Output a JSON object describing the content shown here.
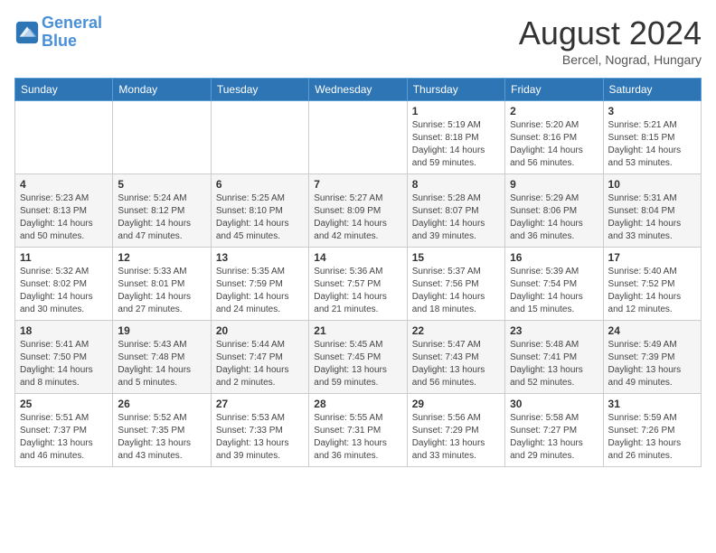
{
  "header": {
    "logo_line1": "General",
    "logo_line2": "Blue",
    "month_year": "August 2024",
    "location": "Bercel, Nograd, Hungary"
  },
  "weekdays": [
    "Sunday",
    "Monday",
    "Tuesday",
    "Wednesday",
    "Thursday",
    "Friday",
    "Saturday"
  ],
  "weeks": [
    [
      {
        "day": "",
        "info": ""
      },
      {
        "day": "",
        "info": ""
      },
      {
        "day": "",
        "info": ""
      },
      {
        "day": "",
        "info": ""
      },
      {
        "day": "1",
        "info": "Sunrise: 5:19 AM\nSunset: 8:18 PM\nDaylight: 14 hours\nand 59 minutes."
      },
      {
        "day": "2",
        "info": "Sunrise: 5:20 AM\nSunset: 8:16 PM\nDaylight: 14 hours\nand 56 minutes."
      },
      {
        "day": "3",
        "info": "Sunrise: 5:21 AM\nSunset: 8:15 PM\nDaylight: 14 hours\nand 53 minutes."
      }
    ],
    [
      {
        "day": "4",
        "info": "Sunrise: 5:23 AM\nSunset: 8:13 PM\nDaylight: 14 hours\nand 50 minutes."
      },
      {
        "day": "5",
        "info": "Sunrise: 5:24 AM\nSunset: 8:12 PM\nDaylight: 14 hours\nand 47 minutes."
      },
      {
        "day": "6",
        "info": "Sunrise: 5:25 AM\nSunset: 8:10 PM\nDaylight: 14 hours\nand 45 minutes."
      },
      {
        "day": "7",
        "info": "Sunrise: 5:27 AM\nSunset: 8:09 PM\nDaylight: 14 hours\nand 42 minutes."
      },
      {
        "day": "8",
        "info": "Sunrise: 5:28 AM\nSunset: 8:07 PM\nDaylight: 14 hours\nand 39 minutes."
      },
      {
        "day": "9",
        "info": "Sunrise: 5:29 AM\nSunset: 8:06 PM\nDaylight: 14 hours\nand 36 minutes."
      },
      {
        "day": "10",
        "info": "Sunrise: 5:31 AM\nSunset: 8:04 PM\nDaylight: 14 hours\nand 33 minutes."
      }
    ],
    [
      {
        "day": "11",
        "info": "Sunrise: 5:32 AM\nSunset: 8:02 PM\nDaylight: 14 hours\nand 30 minutes."
      },
      {
        "day": "12",
        "info": "Sunrise: 5:33 AM\nSunset: 8:01 PM\nDaylight: 14 hours\nand 27 minutes."
      },
      {
        "day": "13",
        "info": "Sunrise: 5:35 AM\nSunset: 7:59 PM\nDaylight: 14 hours\nand 24 minutes."
      },
      {
        "day": "14",
        "info": "Sunrise: 5:36 AM\nSunset: 7:57 PM\nDaylight: 14 hours\nand 21 minutes."
      },
      {
        "day": "15",
        "info": "Sunrise: 5:37 AM\nSunset: 7:56 PM\nDaylight: 14 hours\nand 18 minutes."
      },
      {
        "day": "16",
        "info": "Sunrise: 5:39 AM\nSunset: 7:54 PM\nDaylight: 14 hours\nand 15 minutes."
      },
      {
        "day": "17",
        "info": "Sunrise: 5:40 AM\nSunset: 7:52 PM\nDaylight: 14 hours\nand 12 minutes."
      }
    ],
    [
      {
        "day": "18",
        "info": "Sunrise: 5:41 AM\nSunset: 7:50 PM\nDaylight: 14 hours\nand 8 minutes."
      },
      {
        "day": "19",
        "info": "Sunrise: 5:43 AM\nSunset: 7:48 PM\nDaylight: 14 hours\nand 5 minutes."
      },
      {
        "day": "20",
        "info": "Sunrise: 5:44 AM\nSunset: 7:47 PM\nDaylight: 14 hours\nand 2 minutes."
      },
      {
        "day": "21",
        "info": "Sunrise: 5:45 AM\nSunset: 7:45 PM\nDaylight: 13 hours\nand 59 minutes."
      },
      {
        "day": "22",
        "info": "Sunrise: 5:47 AM\nSunset: 7:43 PM\nDaylight: 13 hours\nand 56 minutes."
      },
      {
        "day": "23",
        "info": "Sunrise: 5:48 AM\nSunset: 7:41 PM\nDaylight: 13 hours\nand 52 minutes."
      },
      {
        "day": "24",
        "info": "Sunrise: 5:49 AM\nSunset: 7:39 PM\nDaylight: 13 hours\nand 49 minutes."
      }
    ],
    [
      {
        "day": "25",
        "info": "Sunrise: 5:51 AM\nSunset: 7:37 PM\nDaylight: 13 hours\nand 46 minutes."
      },
      {
        "day": "26",
        "info": "Sunrise: 5:52 AM\nSunset: 7:35 PM\nDaylight: 13 hours\nand 43 minutes."
      },
      {
        "day": "27",
        "info": "Sunrise: 5:53 AM\nSunset: 7:33 PM\nDaylight: 13 hours\nand 39 minutes."
      },
      {
        "day": "28",
        "info": "Sunrise: 5:55 AM\nSunset: 7:31 PM\nDaylight: 13 hours\nand 36 minutes."
      },
      {
        "day": "29",
        "info": "Sunrise: 5:56 AM\nSunset: 7:29 PM\nDaylight: 13 hours\nand 33 minutes."
      },
      {
        "day": "30",
        "info": "Sunrise: 5:58 AM\nSunset: 7:27 PM\nDaylight: 13 hours\nand 29 minutes."
      },
      {
        "day": "31",
        "info": "Sunrise: 5:59 AM\nSunset: 7:26 PM\nDaylight: 13 hours\nand 26 minutes."
      }
    ]
  ]
}
